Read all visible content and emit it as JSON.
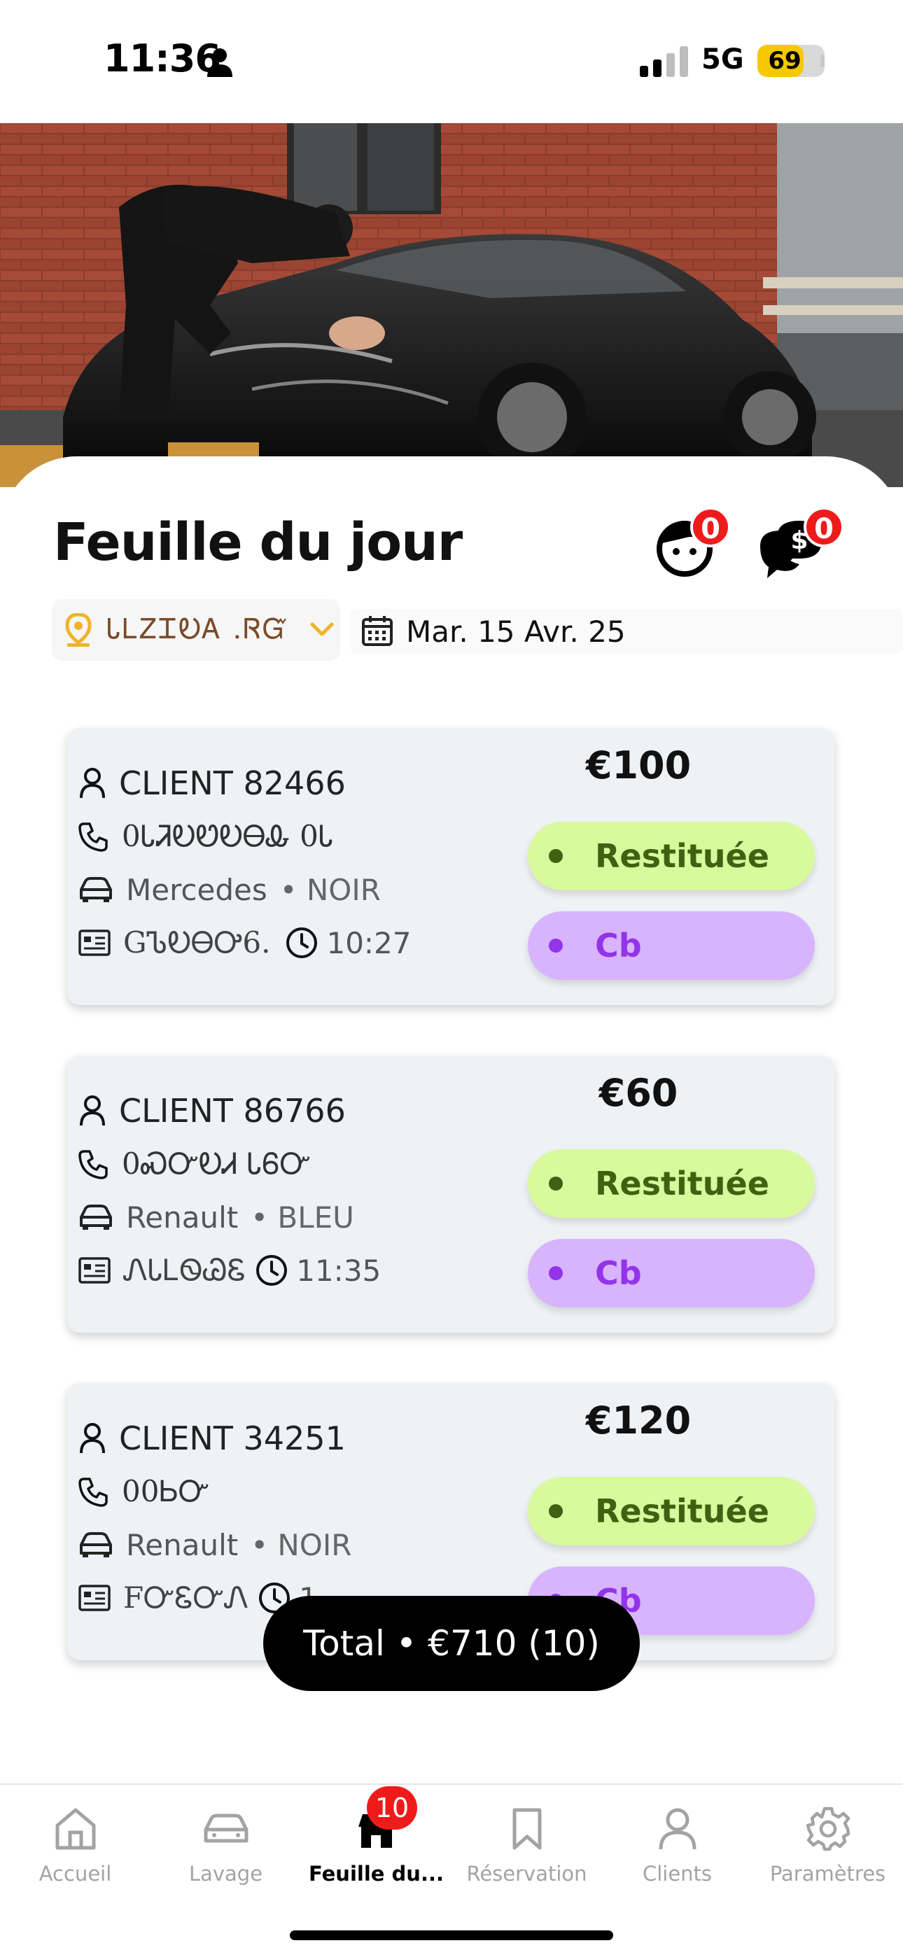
{
  "status_bar": {
    "time": "11:36",
    "network": "5G",
    "battery": "69",
    "battery_level": 0.69
  },
  "header": {
    "title": "Feuille du jour",
    "clients_badge": "0",
    "payments_badge": "0",
    "location_value": "ᏓᏞᏃᏆᎧᎪ .ᏒᏳ",
    "date": "Mar. 15 Avr. 25"
  },
  "cards": [
    {
      "client": "CLIENT 82466",
      "phone": "0ᏓᏘᎧᏬᎧᎾᎲ 0Ꮣ",
      "car_brand": "Mercedes",
      "car_color": "• NOIR",
      "plate": "GᏖᎧᎾᎤ6.",
      "time": "10:27",
      "price": "€100",
      "status": "Restituée",
      "payment": "Cb"
    },
    {
      "client": "CLIENT 86766",
      "phone": "0ᏍᏅᎧᏗ ᏓᏮᏅ",
      "car_brand": "Renault",
      "car_color": "• BLEU",
      "plate": "ᏁᏓᏞᏫᏊᏋ",
      "time": "11:35",
      "price": "€60",
      "status": "Restituée",
      "payment": "Cb"
    },
    {
      "client": "CLIENT 34251",
      "phone": "00ᏏᏅ",
      "car_brand": "Renault",
      "car_color": "• NOIR",
      "plate": "FᏅᏋᏅᏁ",
      "time": "1",
      "price": "€120",
      "status": "Restituée",
      "payment": "Cb"
    }
  ],
  "total": "Total • €710 (10)",
  "tabbar": {
    "items": [
      {
        "label": "Accueil",
        "icon": "home-icon"
      },
      {
        "label": "Lavage",
        "icon": "car-icon"
      },
      {
        "label": "Feuille du...",
        "icon": "store-icon"
      },
      {
        "label": "Réservation",
        "icon": "bookmark-icon"
      },
      {
        "label": "Clients",
        "icon": "user-icon"
      },
      {
        "label": "Paramètres",
        "icon": "gear-icon"
      }
    ],
    "active_index": 2,
    "badge": "10"
  },
  "colors": {
    "status_green_bg": "#d9f99d",
    "status_green_text": "#3f6212",
    "payment_purple_bg": "#d8b4fe",
    "payment_purple_text": "#9333ea",
    "badge_red": "#ef1b1b",
    "location_pin": "#f0b429"
  }
}
